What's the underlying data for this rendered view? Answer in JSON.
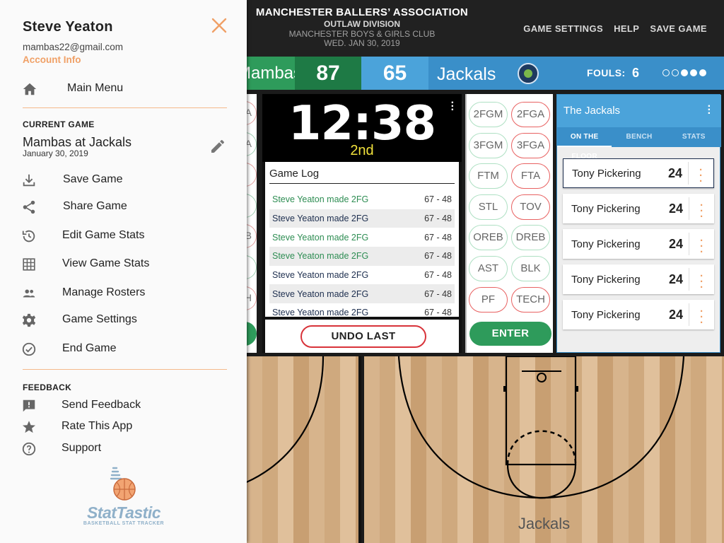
{
  "header": {
    "org_name": "MANCHESTER BALLERS’ ASSOCIATION",
    "division": "OUTLAW DIVISION",
    "venue": "MANCHESTER BOYS & GIRLS CLUB",
    "date": "WED. JAN 30, 2019",
    "nav": {
      "game_settings": "GAME SETTINGS",
      "help": "HELP",
      "save_game": "SAVE GAME"
    }
  },
  "scoreboard": {
    "home_name": "Mambas",
    "home_score": "87",
    "away_score": "65",
    "away_name": "Jackals",
    "fouls_label": "FOULS:",
    "fouls_value": "6",
    "foul_dots": [
      false,
      false,
      true,
      true,
      true
    ],
    "colors": {
      "home_primary": "#2e9b5b",
      "home_dark": "#1e7a45",
      "away_primary": "#3a8fc9",
      "away_light": "#4ba3da"
    }
  },
  "left_column": {
    "partial_labels": [
      "A",
      "A",
      "",
      "",
      "B",
      "",
      "H"
    ]
  },
  "timer": {
    "clock": "12:38",
    "period": "2nd",
    "menu_icon": "more-vert-icon"
  },
  "game_log": {
    "title": "Game Log",
    "rows": [
      {
        "text": "Steve Yeaton made 2FG",
        "score": "67 - 48",
        "color": "green"
      },
      {
        "text": "Steve Yeaton made 2FG",
        "score": "67 - 48",
        "color": "dark"
      },
      {
        "text": "Steve Yeaton made 2FG",
        "score": "67 - 48",
        "color": "green"
      },
      {
        "text": "Steve Yeaton made 2FG",
        "score": "67 - 48",
        "color": "green"
      },
      {
        "text": "Steve Yeaton made 2FG",
        "score": "67 - 48",
        "color": "dark"
      },
      {
        "text": "Steve Yeaton made 2FG",
        "score": "67 - 48",
        "color": "dark"
      },
      {
        "text": "Steve Yeaton made 2FG",
        "score": "67 - 48",
        "color": "dark"
      }
    ],
    "undo_label": "UNDO LAST"
  },
  "stat_buttons": {
    "made": [
      "2FGM",
      "3FGM",
      "FTM",
      "STL",
      "OREB",
      "AST",
      "PF"
    ],
    "missed": [
      "2FGA",
      "3FGA",
      "FTA",
      "TOV",
      "DREB",
      "BLK",
      "TECH"
    ],
    "made_miss_flags": {
      "made": [
        "made",
        "made",
        "made",
        "made",
        "made",
        "made",
        "miss"
      ],
      "missed": [
        "miss",
        "miss",
        "miss",
        "miss",
        "made",
        "made",
        "miss"
      ]
    },
    "enter_label": "ENTER"
  },
  "roster": {
    "team_name": "The Jackals",
    "tabs": [
      "ON THE FLOOR",
      "BENCH",
      "STATS"
    ],
    "active_tab": 0,
    "players": [
      {
        "name": "Tony Pickering",
        "number": "24",
        "selected": true
      },
      {
        "name": "Tony Pickering",
        "number": "24",
        "selected": false
      },
      {
        "name": "Tony Pickering",
        "number": "24",
        "selected": false
      },
      {
        "name": "Tony Pickering",
        "number": "24",
        "selected": false
      },
      {
        "name": "Tony Pickering",
        "number": "24",
        "selected": false
      }
    ]
  },
  "court": {
    "label": "Jackals"
  },
  "drawer": {
    "user_name": "Steve Yeaton",
    "email": "mambas22@gmail.com",
    "account_info": "Account Info",
    "main_menu": "Main Menu",
    "current_game_header": "CURRENT GAME",
    "game_title": "Mambas at Jackals",
    "game_date": "January 30, 2019",
    "items": [
      {
        "label": "Save Game",
        "icon": "download-icon"
      },
      {
        "label": "Share Game",
        "icon": "share-icon"
      },
      {
        "label": "Edit Game Stats",
        "icon": "history-icon"
      },
      {
        "label": "View Game Stats",
        "icon": "grid-icon"
      },
      {
        "label": "Manage Rosters",
        "icon": "people-icon"
      },
      {
        "label": "Game Settings",
        "icon": "gear-icon"
      },
      {
        "label": "End Game",
        "icon": "check-circle-icon"
      }
    ],
    "feedback_header": "FEEDBACK",
    "feedback_items": [
      {
        "label": "Send Feedback",
        "icon": "feedback-icon"
      },
      {
        "label": "Rate This App",
        "icon": "star-icon"
      },
      {
        "label": "Support",
        "icon": "help-circle-icon"
      }
    ],
    "brand_name": "StatTastic",
    "brand_tagline": "BASKETBALL STAT TRACKER",
    "accent_color": "#f0a066"
  }
}
